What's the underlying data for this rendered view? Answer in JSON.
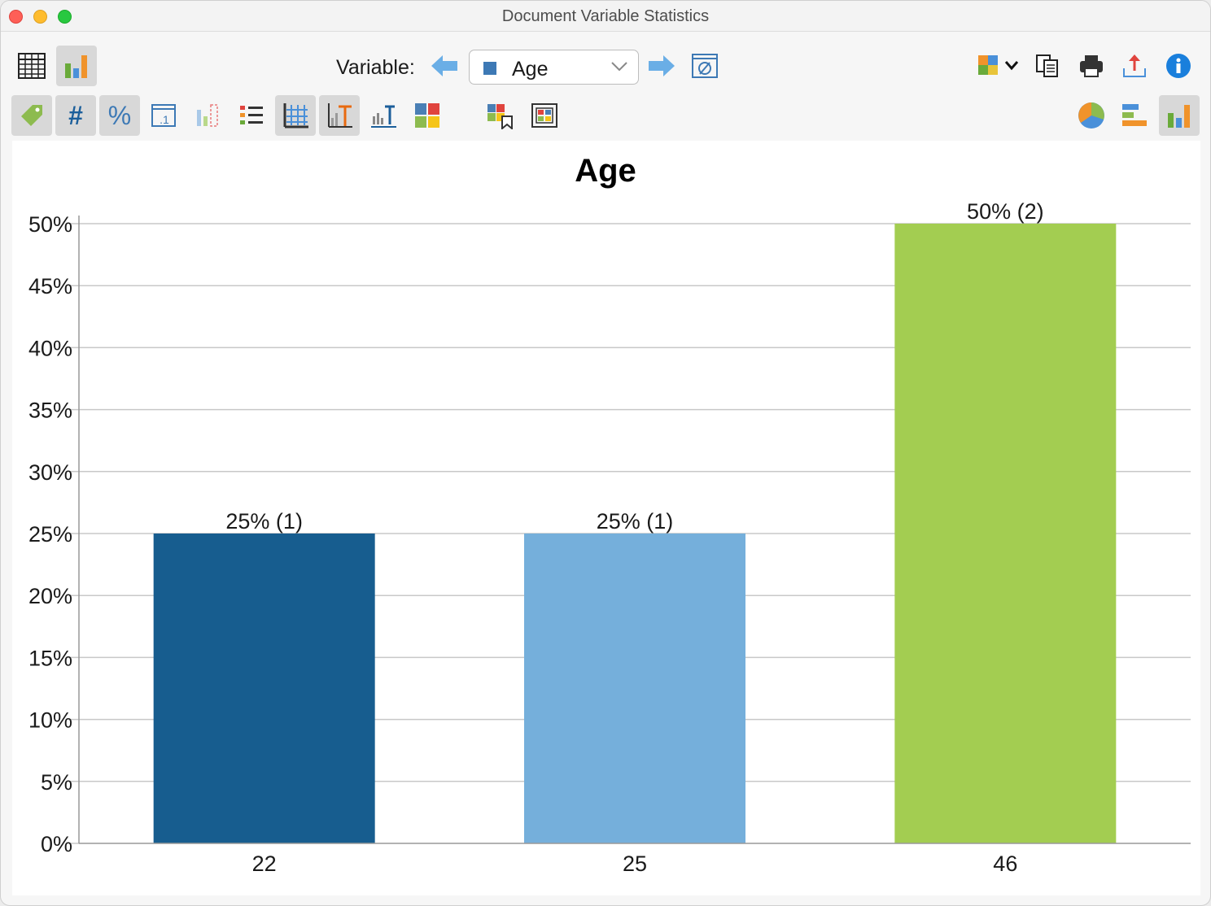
{
  "window": {
    "title": "Document Variable Statistics"
  },
  "toolbar": {
    "variable_label": "Variable:",
    "variable_selected": "Age",
    "buttons_left": [
      "table-view-icon",
      "chart-view-icon"
    ],
    "nav": [
      "previous-variable-arrow-icon",
      "next-variable-arrow-icon",
      "no-filter-icon"
    ],
    "buttons_right": [
      "smart-publisher-icon",
      "copy-icon",
      "print-icon",
      "export-icon",
      "info-icon"
    ]
  },
  "toolbar2": {
    "buttons": [
      "labels-icon",
      "absolute-count-icon",
      "percent-icon",
      "decimal-places-icon",
      "missing-values-icon",
      "legend-icon",
      "gridlines-icon",
      "bar-labels-icon",
      "axis-title-icon",
      "colors-icon",
      "bookmark-icon",
      "frame-icon"
    ],
    "chart_types": [
      "pie-chart-icon",
      "horizontal-bar-chart-icon",
      "vertical-bar-chart-icon"
    ]
  },
  "colors": {
    "bar_22": "#175d8f",
    "bar_25": "#75afdb",
    "bar_46": "#a3cd51",
    "grid": "#c8c8c8"
  },
  "chart_data": {
    "type": "bar",
    "title": "Age",
    "categories": [
      "22",
      "25",
      "46"
    ],
    "values": [
      25,
      25,
      50
    ],
    "counts": [
      1,
      1,
      2
    ],
    "data_labels": [
      "25% (1)",
      "25% (1)",
      "50% (2)"
    ],
    "ylim": [
      0,
      50
    ],
    "yticks": [
      "0%",
      "5%",
      "10%",
      "15%",
      "20%",
      "25%",
      "30%",
      "35%",
      "40%",
      "45%",
      "50%"
    ],
    "grid": true,
    "legend": "none"
  }
}
